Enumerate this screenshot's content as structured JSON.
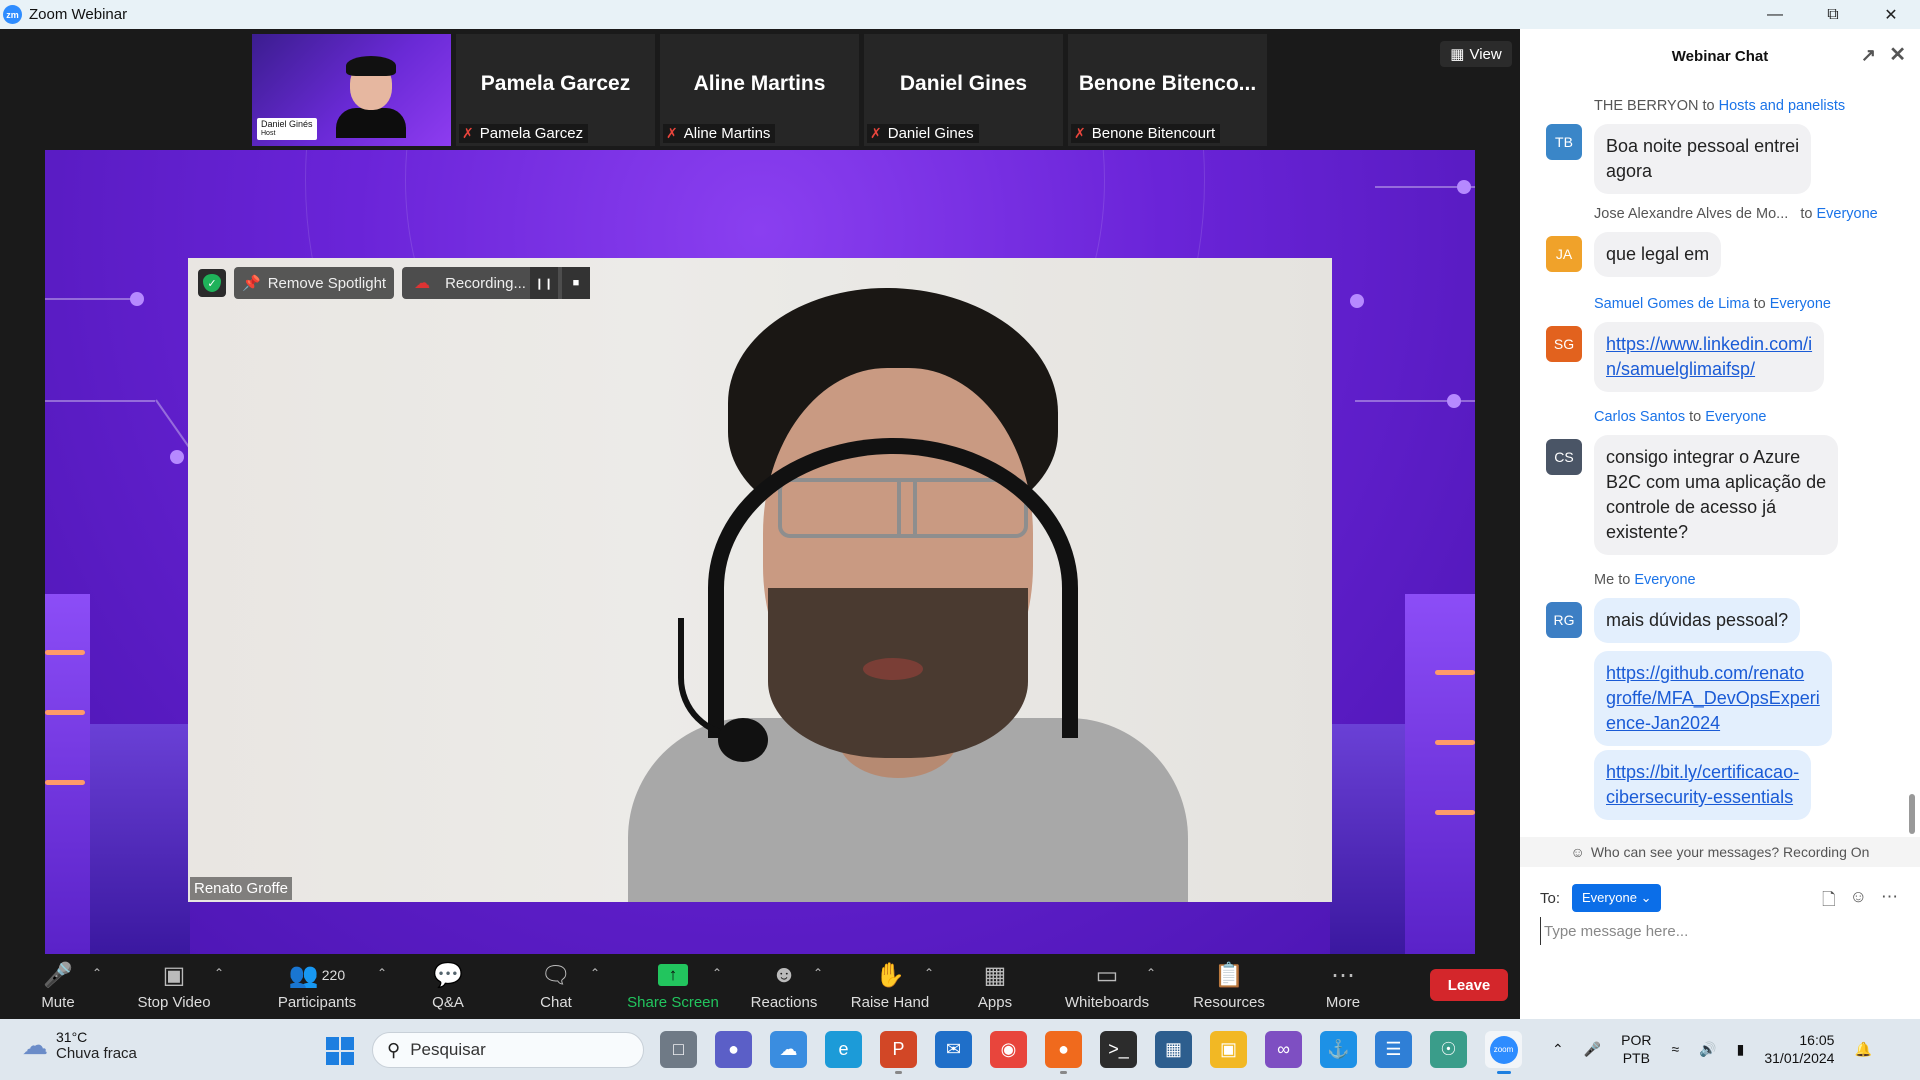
{
  "window": {
    "title": "Zoom Webinar",
    "app_icon": "zm",
    "controls": [
      "minimize-icon",
      "restore-icon",
      "close-icon"
    ]
  },
  "thumbnails": [
    {
      "name": "Daniel Ginés",
      "role": "Host",
      "has_video": true
    },
    {
      "name": "Pamela Garcez",
      "tag": "Pamela Garcez",
      "muted": true
    },
    {
      "name": "Aline Martins",
      "tag": "Aline Martins",
      "muted": true
    },
    {
      "name": "Daniel Gines",
      "tag": "Daniel Gines",
      "muted": true
    },
    {
      "name": "Benone  Bitenco...",
      "tag": "Benone Bitencourt",
      "muted": true
    }
  ],
  "view_button": {
    "label": "View"
  },
  "spotlight": {
    "remove_label": "Remove Spotlight",
    "recording_label": "Recording...",
    "speaker_name": "Renato Groffe"
  },
  "toolbar": {
    "mute": "Mute",
    "stop_video": "Stop Video",
    "participants": "Participants",
    "participants_count": "220",
    "qa": "Q&A",
    "chat": "Chat",
    "share_screen": "Share Screen",
    "reactions": "Reactions",
    "raise_hand": "Raise Hand",
    "apps": "Apps",
    "whiteboards": "Whiteboards",
    "resources": "Resources",
    "more": "More",
    "leave": "Leave",
    "accent_green": "#22c55e",
    "leave_color": "#d4262b"
  },
  "chat": {
    "title": "Webinar Chat",
    "messages": [
      {
        "sender": "THE BERRYON",
        "to_word": "to",
        "recipient": "Hosts and panelists",
        "initials": "TB",
        "color": "#3a86c8",
        "lines": [
          "Boa noite pessoal entrei",
          "agora"
        ]
      },
      {
        "sender": "Jose Alexandre Alves de Mo...",
        "to_word": "to",
        "recipient": "Everyone",
        "initials": "JA",
        "color": "#f0a22a",
        "lines": [
          "que legal em"
        ]
      },
      {
        "sender": "Samuel Gomes de Lima",
        "to_word": "to",
        "recipient": "Everyone",
        "initials": "SG",
        "color": "#e2621e",
        "link_lines": [
          "https://www.linkedin.com/i",
          "n/samuelglimaifsp/"
        ]
      },
      {
        "sender": "Carlos Santos",
        "to_word": "to",
        "recipient": "Everyone",
        "initials": "CS",
        "color": "#4a5566",
        "lines": [
          "consigo integrar o Azure",
          "B2C com uma aplicação de",
          "controle de acesso já",
          "existente?"
        ]
      },
      {
        "sender": "Me",
        "to_word": "to",
        "recipient": "Everyone",
        "initials": "RG",
        "color": "#3d7fc4",
        "lines": [
          "mais dúvidas pessoal?"
        ]
      }
    ],
    "my_links": [
      [
        "https://github.com/renato",
        "groffe/MFA_DevOpsExperi",
        "ence-Jan2024"
      ],
      [
        "https://bit.ly/certificacao-",
        "cibersecurity-essentials"
      ]
    ],
    "notice": "Who can see your messages? Recording On",
    "to_label": "To:",
    "to_value": "Everyone",
    "placeholder": "Type message here..."
  },
  "taskbar": {
    "weather_temp": "31°C",
    "weather_desc": "Chuva fraca",
    "search_placeholder": "Pesquisar",
    "lang_line1": "POR",
    "lang_line2": "PTB",
    "time": "16:05",
    "date": "31/01/2024",
    "apps": [
      "explorer-files-icon",
      "teams-icon",
      "weather-app-icon",
      "edge-icon",
      "powerpoint-icon",
      "mail-icon",
      "chrome-icon",
      "firefox-icon",
      "terminal-icon",
      "dashboard-icon",
      "file-explorer-icon",
      "visual-studio-icon",
      "docker-icon",
      "notepad-icon",
      "remote-icon",
      "zoom-icon"
    ]
  }
}
